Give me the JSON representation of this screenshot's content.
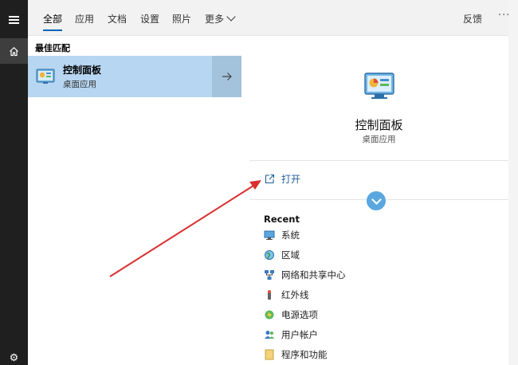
{
  "tabs": [
    {
      "label": "全部",
      "active": true
    },
    {
      "label": "应用"
    },
    {
      "label": "文档"
    },
    {
      "label": "设置"
    },
    {
      "label": "照片"
    },
    {
      "label": "更多"
    }
  ],
  "header": {
    "feedback": "反馈",
    "more_options": "···"
  },
  "best_match": {
    "section_title": "最佳匹配",
    "name": "控制面板",
    "subtitle": "桌面应用",
    "icon": "control-panel-icon"
  },
  "detail": {
    "title": "控制面板",
    "subtitle": "桌面应用",
    "open_label": "打开",
    "recent_title": "Recent",
    "recent_items": [
      {
        "label": "系统",
        "icon": "monitor-icon"
      },
      {
        "label": "区域",
        "icon": "globe-icon"
      },
      {
        "label": "网络和共享中心",
        "icon": "network-icon"
      },
      {
        "label": "红外线",
        "icon": "infrared-icon"
      },
      {
        "label": "电源选项",
        "icon": "power-options-icon"
      },
      {
        "label": "用户帐户",
        "icon": "users-icon"
      },
      {
        "label": "程序和功能",
        "icon": "programs-icon"
      }
    ]
  },
  "colors": {
    "rail": "#1f1f1f",
    "selection": "#b7d6f2",
    "accent": "#0063b1",
    "annotation_arrow": "#d8302f"
  }
}
